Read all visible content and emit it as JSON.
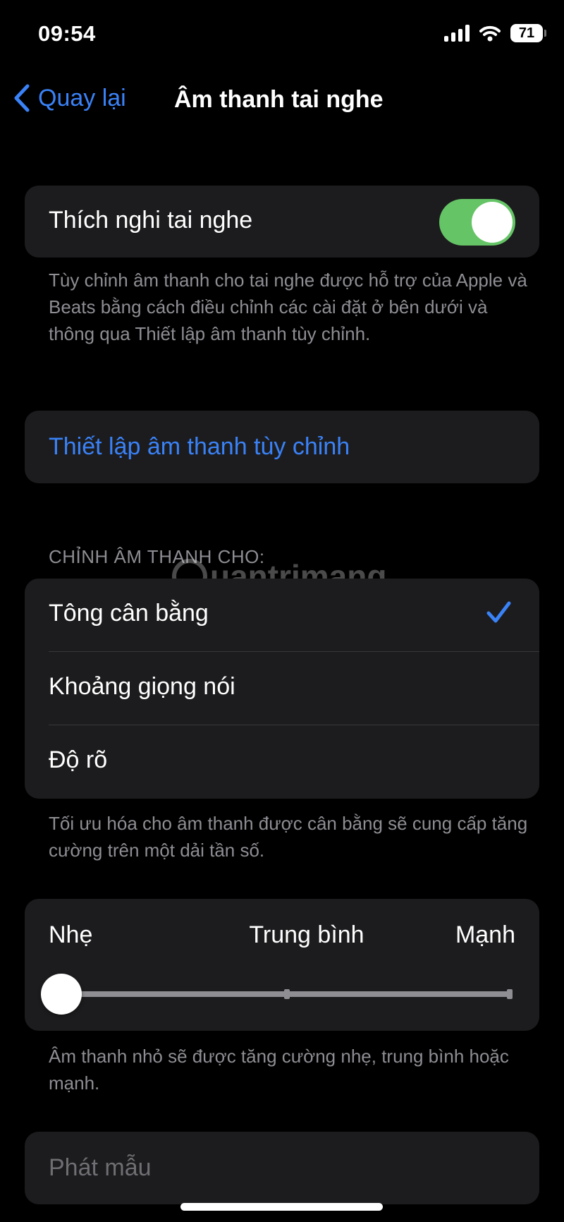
{
  "status_bar": {
    "time": "09:54",
    "battery_level": "71"
  },
  "nav": {
    "back_label": "Quay lại",
    "title": "Âm thanh tai nghe"
  },
  "adaptation": {
    "label": "Thích nghi tai nghe",
    "enabled": true,
    "note": "Tùy chỉnh âm thanh cho tai nghe được hỗ trợ của Apple và Beats bằng cách điều chỉnh các cài đặt ở bên dưới và thông qua Thiết lập âm thanh tùy chỉnh."
  },
  "custom_setup": {
    "label": "Thiết lập âm thanh tùy chỉnh"
  },
  "tune_for": {
    "header": "CHỈNH ÂM THANH CHO:",
    "options": [
      {
        "label": "Tông cân bằng",
        "selected": true
      },
      {
        "label": "Khoảng giọng nói",
        "selected": false
      },
      {
        "label": "Độ rõ",
        "selected": false
      }
    ],
    "note": "Tối ưu hóa cho âm thanh được cân bằng sẽ cung cấp tăng cường trên một dải tần số."
  },
  "strength": {
    "labels": [
      "Nhẹ",
      "Trung bình",
      "Mạnh"
    ],
    "level_fraction": 0,
    "note": "Âm thanh nhỏ sẽ được tăng cường nhẹ, trung bình hoặc mạnh."
  },
  "sample": {
    "label": "Phát mẫu"
  },
  "watermark": {
    "text": "uantrimang"
  },
  "colors": {
    "accent": "#3a82f7",
    "toggle_on": "#65c466",
    "cell_bg": "#1c1c1e",
    "secondary_text": "#8d8d93"
  }
}
